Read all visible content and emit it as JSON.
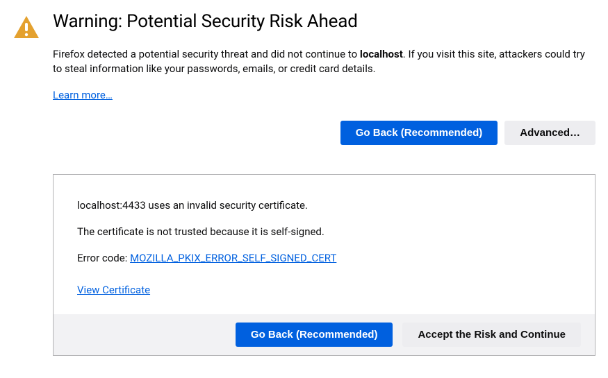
{
  "title": "Warning: Potential Security Risk Ahead",
  "description": {
    "prefix": "Firefox detected a potential security threat and did not continue to ",
    "host": "localhost",
    "suffix": ". If you visit this site, attackers could try to steal information like your passwords, emails, or credit card details."
  },
  "learn_more": "Learn more…",
  "buttons": {
    "go_back": "Go Back (Recommended)",
    "advanced": "Advanced…"
  },
  "advanced_panel": {
    "line1": "localhost:4433 uses an invalid security certificate.",
    "line2": "The certificate is not trusted because it is self-signed.",
    "error_label": "Error code: ",
    "error_code": "MOZILLA_PKIX_ERROR_SELF_SIGNED_CERT",
    "view_certificate": "View Certificate",
    "footer": {
      "go_back": "Go Back (Recommended)",
      "accept": "Accept the Risk and Continue"
    }
  },
  "colors": {
    "primary": "#0060df",
    "warning": "#e4a12f",
    "secondary_bg": "#ededf0"
  }
}
